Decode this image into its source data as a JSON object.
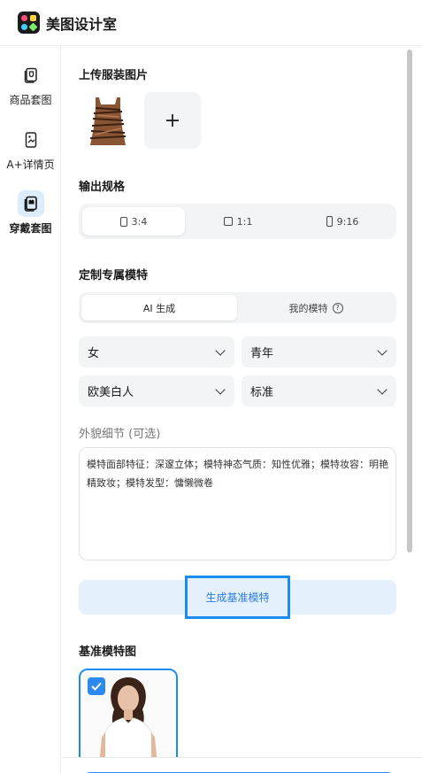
{
  "app": {
    "name": "美图设计室"
  },
  "sidebar": {
    "items": [
      {
        "label": "商品套图",
        "icon": "product-set-icon"
      },
      {
        "label": "A+详情页",
        "icon": "detail-page-icon"
      },
      {
        "label": "穿戴套图",
        "icon": "wearable-set-icon",
        "active": true
      }
    ]
  },
  "upload": {
    "title": "上传服装图片",
    "add_symbol": "+"
  },
  "ratio": {
    "title": "输出规格",
    "options": [
      "3:4",
      "1:1",
      "9:16"
    ],
    "selected": "3:4"
  },
  "model": {
    "title": "定制专属模特",
    "tabs": [
      "AI 生成",
      "我的模特"
    ],
    "selected_tab": "AI 生成",
    "help_symbol": "?",
    "selects": {
      "gender": "女",
      "age": "青年",
      "ethnicity": "欧美白人",
      "body": "标准"
    },
    "details_label": "外貌细节 (可选)",
    "details_value": "模特面部特征：深邃立体；模特神态气质：知性优雅；模特妆容：明艳精致妆；模特发型：慵懒微卷",
    "generate_label": "生成基准模特"
  },
  "base_model": {
    "title": "基准模特图",
    "selected": true
  },
  "colors": {
    "accent": "#1a8cf0",
    "accent_light": "#e4f0fc",
    "panel": "#f3f4f6"
  }
}
